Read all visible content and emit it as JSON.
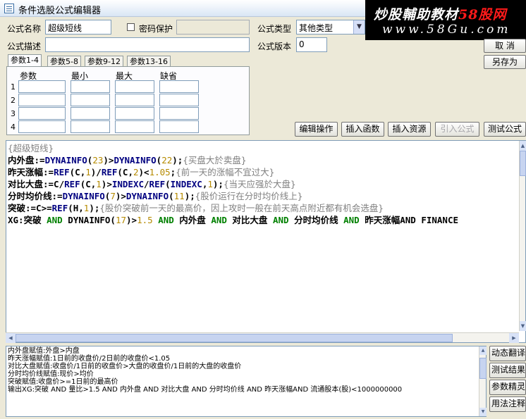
{
  "window": {
    "title": "条件选股公式编辑器"
  },
  "watermark": {
    "line1_prefix": "炒股輔助教材",
    "line1_brand": "58股网",
    "line2": "www.58Gu.com"
  },
  "form": {
    "name_label": "公式名称",
    "name_value": "超级短线",
    "password_label": "密码保护",
    "password_checked": false,
    "type_label": "公式类型",
    "type_value": "其他类型",
    "desc_label": "公式描述",
    "desc_value": "",
    "version_label": "公式版本",
    "version_value": "0"
  },
  "buttons": {
    "cancel": "取 消",
    "save_as": "另存为",
    "edit_ops": "编辑操作",
    "insert_func": "插入函数",
    "insert_res": "插入资源",
    "import_formula": "引入公式",
    "test_formula": "测试公式"
  },
  "tabs": [
    "参数1-4",
    "参数5-8",
    "参数9-12",
    "参数13-16"
  ],
  "params": {
    "headers": [
      "参数",
      "最小",
      "最大",
      "缺省"
    ],
    "rows": [
      "1",
      "2",
      "3",
      "4"
    ]
  },
  "code": {
    "l1": "{超级短线}",
    "l2": [
      "内外盘:=",
      "DYNAINFO",
      "(",
      "23",
      ")>",
      "DYNAINFO",
      "(",
      "22",
      ");",
      "{买盘大於卖盘}"
    ],
    "l3": [
      "昨天涨幅:=",
      "REF",
      "(C,",
      "1",
      ")/",
      "REF",
      "(C,",
      "2",
      ")<",
      "1.05",
      ";",
      "{前一天的涨幅不宜过大}"
    ],
    "l4": [
      "对比大盘:=C/",
      "REF",
      "(C,",
      "1",
      ")>",
      "INDEXC",
      "/",
      "REF",
      "(",
      "INDEXC",
      ",",
      "1",
      ");",
      "{当天应强於大盘}"
    ],
    "l5": [
      "分时均价线:=",
      "DYNAINFO",
      "(",
      "7",
      ")>",
      "DYNAINFO",
      "(",
      "11",
      ");",
      "{股价运行在分时均价线上}"
    ],
    "l6": [
      "突破:=C>=",
      "REF",
      "(H,",
      "1",
      ");",
      "{股价突破前一天的最高价，因上攻时一般在前天高点附近都有机会选盘}"
    ],
    "l7": [
      "XG:突破 ",
      "AND",
      " DYNAINFO(",
      "17",
      ")>",
      "1.5",
      " ",
      "AND",
      " 内外盘 ",
      "AND",
      " 对比大盘 ",
      "AND",
      " 分时均价线 ",
      "AND",
      " 昨天涨幅AND FINANCE"
    ]
  },
  "output": [
    "内外盘赋值:外盘>内盘",
    "昨天涨幅赋值:1日前的收盘价/2日前的收盘价<1.05",
    "对比大盘赋值:收盘价/1日前的收盘价>大盘的收盘价/1日前的大盘的收盘价",
    "分时均价线赋值:现价>均价",
    "突破赋值:收盘价>=1日前的最高价",
    "输出XG:突破 AND 量比>1.5 AND 内外盘 AND 对比大盘 AND 分时均价线 AND 昨天涨幅AND 流通股本(股)<1000000000"
  ],
  "side_buttons": [
    "动态翻译",
    "测试结果",
    "参数精灵",
    "用法注释"
  ],
  "colors": {
    "keyword_green": "#008000",
    "number_gold": "#b58a00",
    "comment_gray": "#808080",
    "brand_red": "#ff1a1a"
  }
}
